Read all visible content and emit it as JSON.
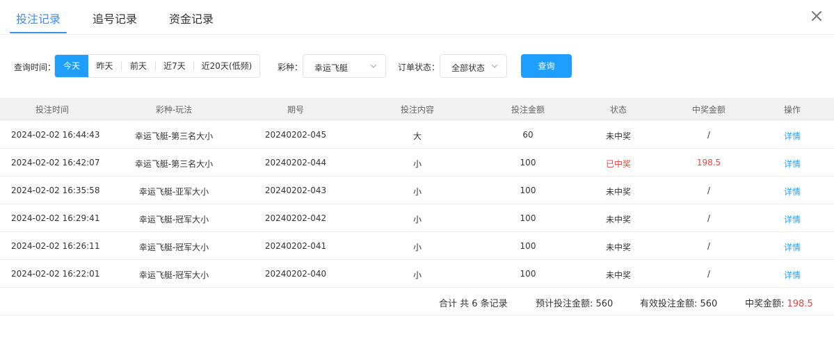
{
  "tabs": [
    {
      "label": "投注记录",
      "active": true
    },
    {
      "label": "追号记录",
      "active": false
    },
    {
      "label": "资金记录",
      "active": false
    }
  ],
  "filter": {
    "time_label": "查询时间：",
    "time_options": [
      {
        "label": "今天",
        "active": true
      },
      {
        "label": "昨天",
        "active": false
      },
      {
        "label": "前天",
        "active": false
      },
      {
        "label": "近7天",
        "active": false
      },
      {
        "label": "近20天(低频)",
        "active": false
      }
    ],
    "lottery_label": "彩种：",
    "lottery_value": "幸运飞艇",
    "status_label": "订单状态：",
    "status_value": "全部状态",
    "query_label": "查询"
  },
  "table": {
    "headers": [
      "投注时间",
      "彩种-玩法",
      "期号",
      "投注内容",
      "投注金额",
      "状态",
      "中奖金额",
      "操作"
    ],
    "rows": [
      {
        "time": "2024-02-02 16:44:43",
        "play": "幸运飞艇-第三名大小",
        "issue": "20240202-045",
        "content": "大",
        "amount": "60",
        "status": "未中奖",
        "win": "/",
        "action": "详情",
        "won": false
      },
      {
        "time": "2024-02-02 16:42:07",
        "play": "幸运飞艇-第三名大小",
        "issue": "20240202-044",
        "content": "小",
        "amount": "100",
        "status": "已中奖",
        "win": "198.5",
        "action": "详情",
        "won": true
      },
      {
        "time": "2024-02-02 16:35:58",
        "play": "幸运飞艇-亚军大小",
        "issue": "20240202-043",
        "content": "小",
        "amount": "100",
        "status": "未中奖",
        "win": "/",
        "action": "详情",
        "won": false
      },
      {
        "time": "2024-02-02 16:29:41",
        "play": "幸运飞艇-冠军大小",
        "issue": "20240202-042",
        "content": "小",
        "amount": "100",
        "status": "未中奖",
        "win": "/",
        "action": "详情",
        "won": false
      },
      {
        "time": "2024-02-02 16:26:11",
        "play": "幸运飞艇-冠军大小",
        "issue": "20240202-041",
        "content": "小",
        "amount": "100",
        "status": "未中奖",
        "win": "/",
        "action": "详情",
        "won": false
      },
      {
        "time": "2024-02-02 16:22:01",
        "play": "幸运飞艇-冠军大小",
        "issue": "20240202-040",
        "content": "小",
        "amount": "100",
        "status": "未中奖",
        "win": "/",
        "action": "详情",
        "won": false
      }
    ]
  },
  "summary": {
    "count_text": "合计 共 6 条记录",
    "expected_label": "预计投注金额: ",
    "expected_value": "560",
    "valid_label": "有效投注金额: ",
    "valid_value": "560",
    "win_label": "中奖金额: ",
    "win_value": "198.5"
  },
  "colors": {
    "accent": "#1e9fff",
    "tab_active": "#3a8ee6",
    "win_red": "#e64340"
  },
  "icons": {
    "close": "close-icon",
    "chevron": "chevron-down-icon"
  }
}
